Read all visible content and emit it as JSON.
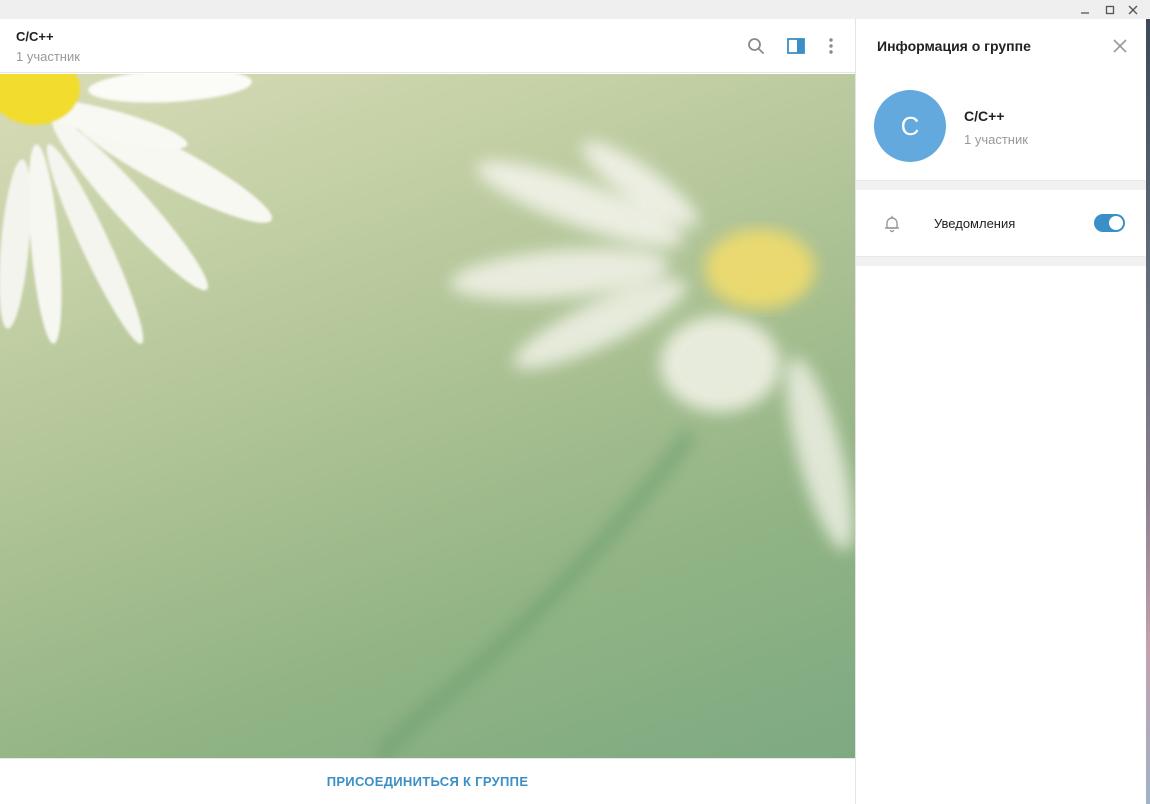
{
  "window": {
    "controls": [
      "minimize-icon",
      "maximize-icon",
      "close-icon"
    ]
  },
  "chat": {
    "title": "C/C++",
    "subtitle": "1 участник",
    "header_icons": [
      "search-icon",
      "sidebar-toggle-icon",
      "more-vertical-icon"
    ],
    "join_label": "ПРИСОЕДИНИТЬСЯ К ГРУППЕ"
  },
  "info_panel": {
    "title": "Информация о группе",
    "avatar_letter": "C",
    "group_name": "C/C++",
    "members": "1 участник",
    "notifications_label": "Уведомления",
    "notifications_enabled": true
  },
  "colors": {
    "accent": "#3a8fc7",
    "avatar": "#64a9dd",
    "text_primary": "#222222",
    "text_secondary": "#999999"
  }
}
